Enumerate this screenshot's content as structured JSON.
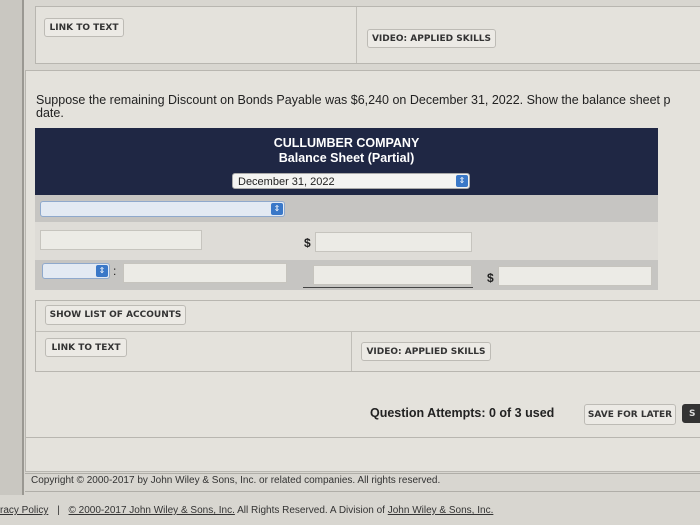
{
  "top_panel": {
    "link_to_text": "LINK TO TEXT",
    "video": "VIDEO: APPLIED SKILLS"
  },
  "question": {
    "text": "Suppose the remaining Discount on Bonds Payable was $6,240 on December 31, 2022. Show the balance sheet p",
    "text2": "date."
  },
  "balance_sheet": {
    "company": "CULLUMBER COMPANY",
    "title": "Balance Sheet (Partial)",
    "date_select": "December 31, 2022",
    "currency": "$",
    "colon": ":"
  },
  "buttons": {
    "show_list": "SHOW LIST OF ACCOUNTS",
    "link_to_text": "LINK TO TEXT",
    "video": "VIDEO: APPLIED SKILLS",
    "save_for_later": "SAVE FOR LATER",
    "submit_partial": "S"
  },
  "attempts": "Question Attempts: 0 of 3 used",
  "copyright": "Copyright © 2000-2017 by John Wiley & Sons, Inc. or related companies. All rights reserved.",
  "footer": {
    "privacy": "racy Policy",
    "sep": "|",
    "copyright_link": "© 2000-2017 John Wiley & Sons, Inc.",
    "rest": " All Rights Reserved. A Division of ",
    "wiley_link": "John Wiley & Sons, Inc."
  }
}
